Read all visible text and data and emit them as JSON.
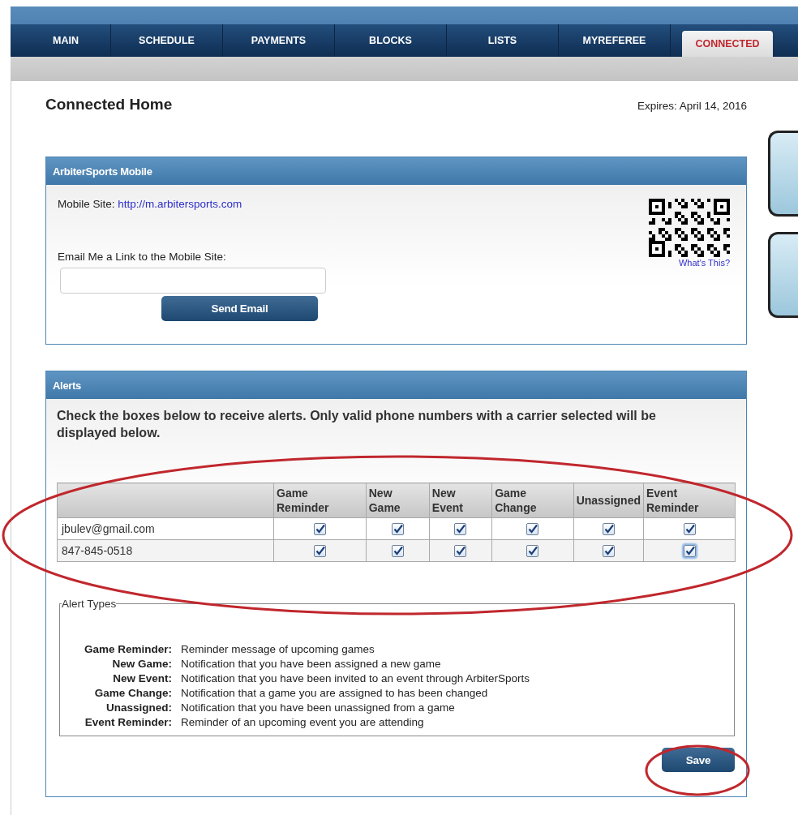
{
  "nav_tabs": [
    {
      "label": "MAIN",
      "selected": false
    },
    {
      "label": "SCHEDULE",
      "selected": false
    },
    {
      "label": "PAYMENTS",
      "selected": false
    },
    {
      "label": "BLOCKS",
      "selected": false
    },
    {
      "label": "LISTS",
      "selected": false
    },
    {
      "label": "MYREFEREE",
      "selected": false
    },
    {
      "label": "CONNECTED",
      "selected": true
    }
  ],
  "page_title": "Connected Home",
  "expires": "Expires: April 14, 2016",
  "mobile_panel": {
    "header": "ArbiterSports Mobile",
    "site_label": "Mobile Site:",
    "site_link": "http://m.arbitersports.com",
    "email_label": "Email Me a Link to the Mobile Site:",
    "send_button": "Send Email",
    "qr_link": "What's This?"
  },
  "alerts_panel": {
    "header": "Alerts",
    "instructions": "Check the boxes below to receive alerts. Only valid phone numbers with a carrier selected will be displayed below.",
    "columns": [
      "Game Reminder",
      "New Game",
      "New Event",
      "Game Change",
      "Unassigned",
      "Event Reminder"
    ],
    "rows": [
      {
        "contact": "jbulev@gmail.com",
        "checks": [
          {
            "checked": true,
            "focused": false
          },
          {
            "checked": true,
            "focused": false
          },
          {
            "checked": true,
            "focused": false
          },
          {
            "checked": true,
            "focused": false
          },
          {
            "checked": true,
            "focused": false
          },
          {
            "checked": true,
            "focused": false
          }
        ]
      },
      {
        "contact": "847-845-0518",
        "checks": [
          {
            "checked": true,
            "focused": false
          },
          {
            "checked": true,
            "focused": false
          },
          {
            "checked": true,
            "focused": false
          },
          {
            "checked": true,
            "focused": false
          },
          {
            "checked": true,
            "focused": false
          },
          {
            "checked": true,
            "focused": true
          }
        ]
      }
    ],
    "legend": "Alert Types",
    "definitions": [
      {
        "term": "Game Reminder:",
        "text": "Reminder message of upcoming games"
      },
      {
        "term": "New Game:",
        "text": "Notification that you have been assigned a new game"
      },
      {
        "term": "New Event:",
        "text": "Notification that you have been invited to an event through ArbiterSports"
      },
      {
        "term": "Game Change:",
        "text": "Notification that a game you are assigned to has been changed"
      },
      {
        "term": "Unassigned:",
        "text": "Notification that you have been unassigned from a game"
      },
      {
        "term": "Event Reminder:",
        "text": "Reminder of an upcoming event you are attending"
      }
    ],
    "save_button": "Save"
  }
}
